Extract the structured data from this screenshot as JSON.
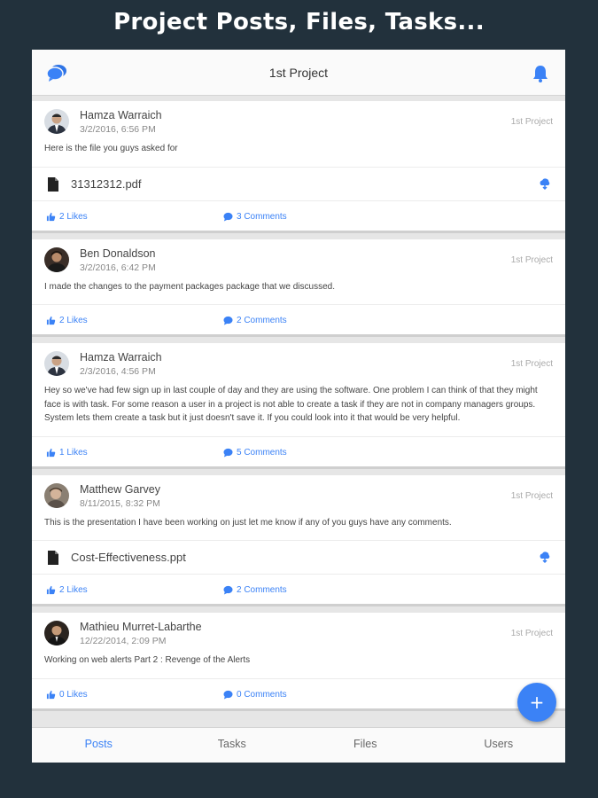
{
  "headline": "Project Posts, Files, Tasks...",
  "colors": {
    "accent": "#3b82f6",
    "background": "#22313c"
  },
  "appbar": {
    "title": "1st Project",
    "left_icon": "chat-bubbles-icon",
    "right_icon": "bell-icon"
  },
  "posts": [
    {
      "author": "Hamza Warraich",
      "date": "3/2/2016, 6:56 PM",
      "project": "1st Project",
      "text": "Here is the file you guys asked for",
      "file": "31312312.pdf",
      "likes": "2 Likes",
      "comments": "3 Comments"
    },
    {
      "author": "Ben Donaldson",
      "date": "3/2/2016, 6:42 PM",
      "project": "1st Project",
      "text": "I made the changes to the payment packages package that we discussed.",
      "likes": "2 Likes",
      "comments": "2 Comments"
    },
    {
      "author": "Hamza Warraich",
      "date": "2/3/2016, 4:56 PM",
      "project": "1st Project",
      "text": "Hey so we've had few sign up in last couple of day and they are using the software. One problem I can think of that they might face is with task. For some reason a user in a project is not able to create a task if they are not in company managers groups. System lets them create a task but it just doesn't save it. If you could look into it that would be very helpful.",
      "likes": "1 Likes",
      "comments": "5 Comments"
    },
    {
      "author": "Matthew Garvey",
      "date": "8/11/2015, 8:32 PM",
      "project": "1st Project",
      "text": "This is the presentation I have been working on just let me know if any of you guys have any comments.",
      "file": "Cost-Effectiveness.ppt",
      "likes": "2 Likes",
      "comments": "2 Comments"
    },
    {
      "author": "Mathieu Murret-Labarthe",
      "date": "12/22/2014, 2:09 PM",
      "project": "1st Project",
      "text": "Working on web alerts Part 2 : Revenge of the Alerts",
      "likes": "0 Likes",
      "comments": "0 Comments"
    }
  ],
  "fab": {
    "label": "+"
  },
  "tabs": [
    {
      "label": "Posts",
      "active": true
    },
    {
      "label": "Tasks"
    },
    {
      "label": "Files"
    },
    {
      "label": "Users"
    }
  ]
}
